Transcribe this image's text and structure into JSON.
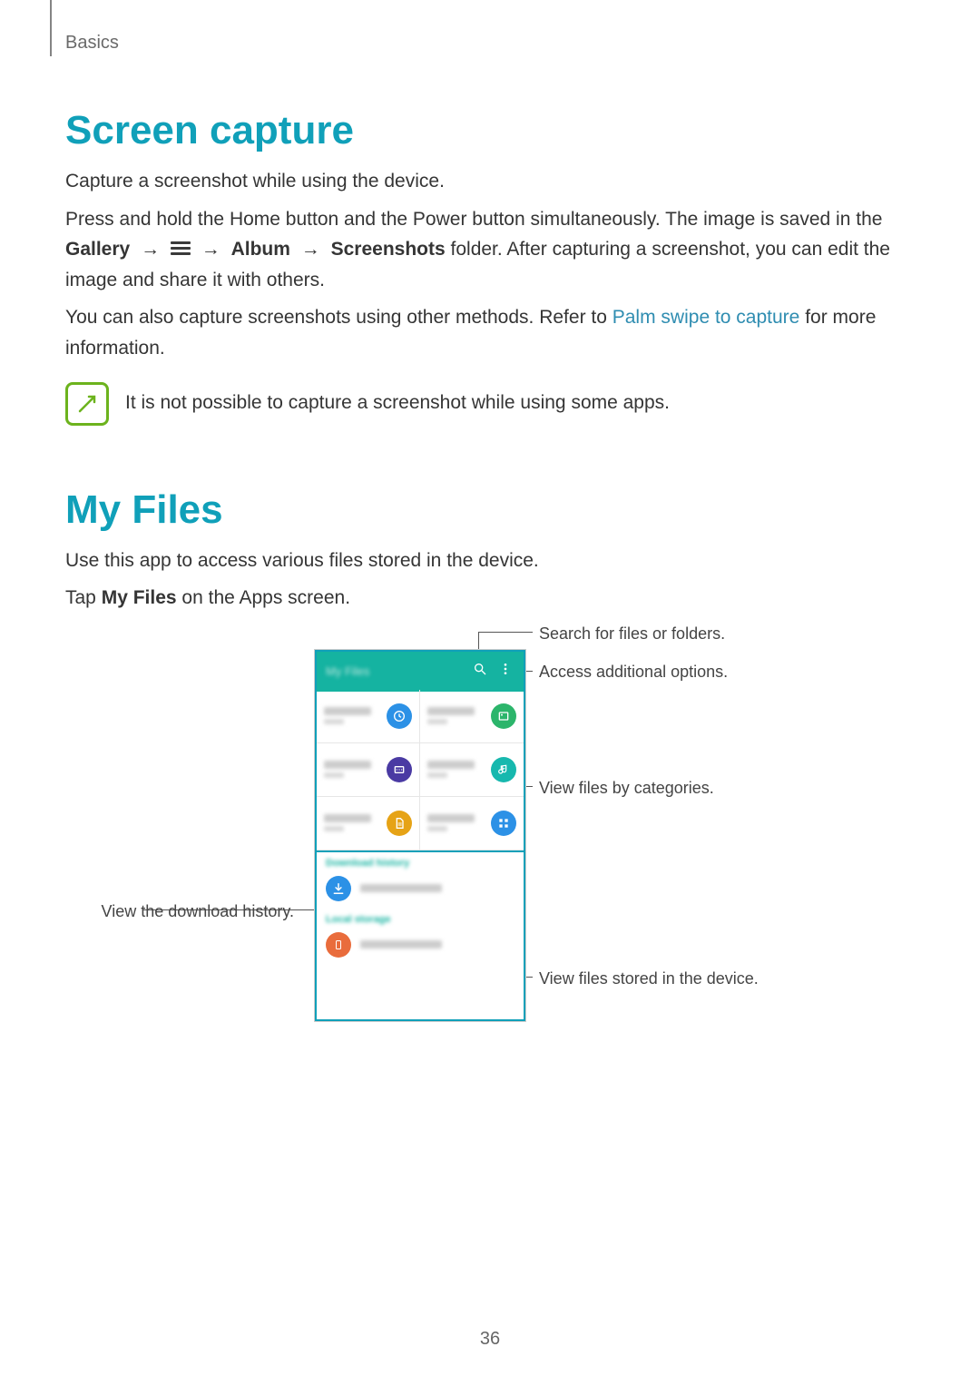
{
  "breadcrumb": "Basics",
  "page_number": "36",
  "section1": {
    "heading": "Screen capture",
    "p1": "Capture a screenshot while using the device.",
    "p2a": "Press and hold the Home button and the Power button simultaneously. The image is saved in the ",
    "gallery": "Gallery",
    "album": "Album",
    "screenshots": "Screenshots",
    "p2b": " folder. After capturing a screenshot, you can edit the image and share it with others.",
    "p3a": "You can also capture screenshots using other methods. Refer to ",
    "link": "Palm swipe to capture",
    "p3b": " for more information.",
    "note": "It is not possible to capture a screenshot while using some apps."
  },
  "section2": {
    "heading": "My Files",
    "p1": "Use this app to access various files stored in the device.",
    "p2a": "Tap ",
    "myfiles": "My Files",
    "p2b": " on the Apps screen."
  },
  "phone": {
    "title": "My Files",
    "categories": [
      {
        "name": "Recent files",
        "icon_color": "#2c91e6",
        "glyph": "clock"
      },
      {
        "name": "Images",
        "icon_color": "#2cb56b",
        "glyph": "image"
      },
      {
        "name": "Videos",
        "icon_color": "#4a3aa3",
        "glyph": "video"
      },
      {
        "name": "Audio",
        "icon_color": "#17b8ae",
        "glyph": "music"
      },
      {
        "name": "Documents",
        "icon_color": "#e6a316",
        "glyph": "doc"
      },
      {
        "name": "Downloaded apps",
        "icon_color": "#2c91e6",
        "glyph": "apps"
      }
    ],
    "dl_section": "Download history",
    "dl_row": "Download history",
    "storage_section": "Local storage",
    "storage_row": "Device storage"
  },
  "callouts": {
    "search": "Search for files or folders.",
    "options": "Access additional options.",
    "categories": "View files by categories.",
    "dlhistory": "View the download history.",
    "devstorage": "View files stored in the device."
  }
}
